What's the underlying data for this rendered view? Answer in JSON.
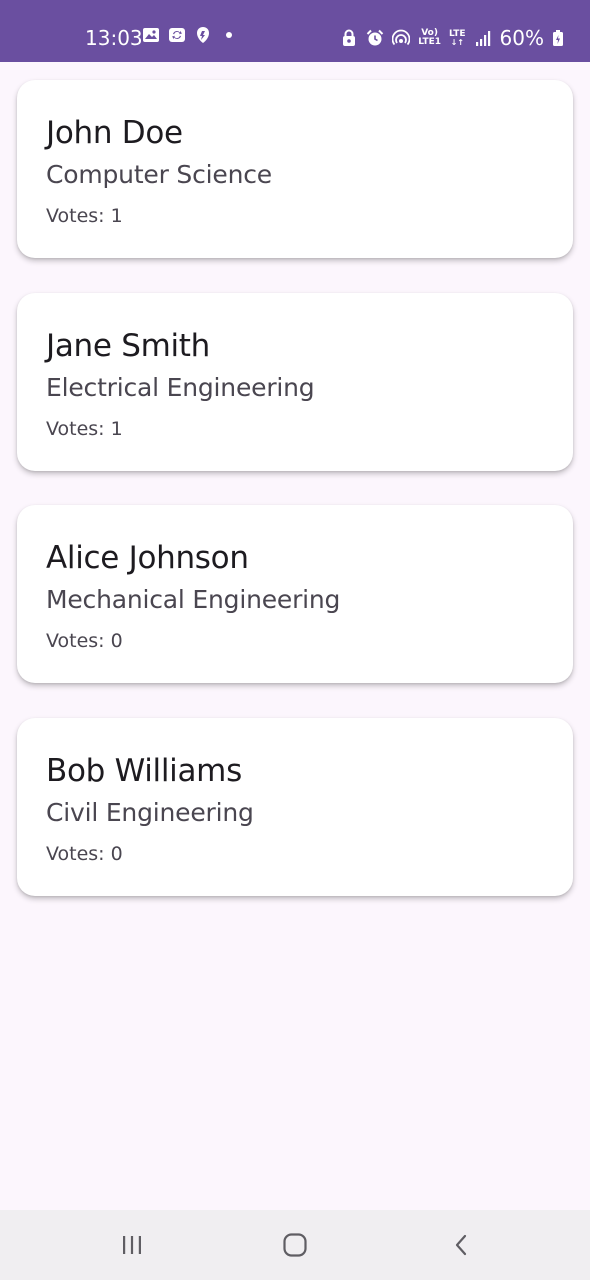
{
  "status_bar": {
    "time": "13:03",
    "battery": "60%",
    "network_top": "Vo)",
    "network_bottom": "LTE1",
    "lte_label": "LTE",
    "left_icons": [
      "gallery-icon",
      "sync-icon",
      "shield-icon",
      "dot-icon"
    ],
    "right_icons": [
      "lock-icon",
      "alarm-icon",
      "hotspot-icon",
      "signal-icon",
      "battery-icon"
    ]
  },
  "candidates": [
    {
      "name": "John Doe",
      "department": "Computer Science",
      "votes": "Votes: 1"
    },
    {
      "name": "Jane Smith",
      "department": "Electrical Engineering",
      "votes": "Votes: 1"
    },
    {
      "name": "Alice Johnson",
      "department": "Mechanical Engineering",
      "votes": "Votes: 0"
    },
    {
      "name": "Bob Williams",
      "department": "Civil Engineering",
      "votes": "Votes: 0"
    }
  ],
  "navigation": {
    "icons": [
      "recents-icon",
      "home-icon",
      "back-icon"
    ]
  },
  "colors": {
    "status_bar": "#6a4fa0",
    "background": "#fcf6fd",
    "card": "#ffffff",
    "name_text": "#1d1b20",
    "secondary_text": "#4a4650",
    "nav_bar": "#f0eef1"
  }
}
